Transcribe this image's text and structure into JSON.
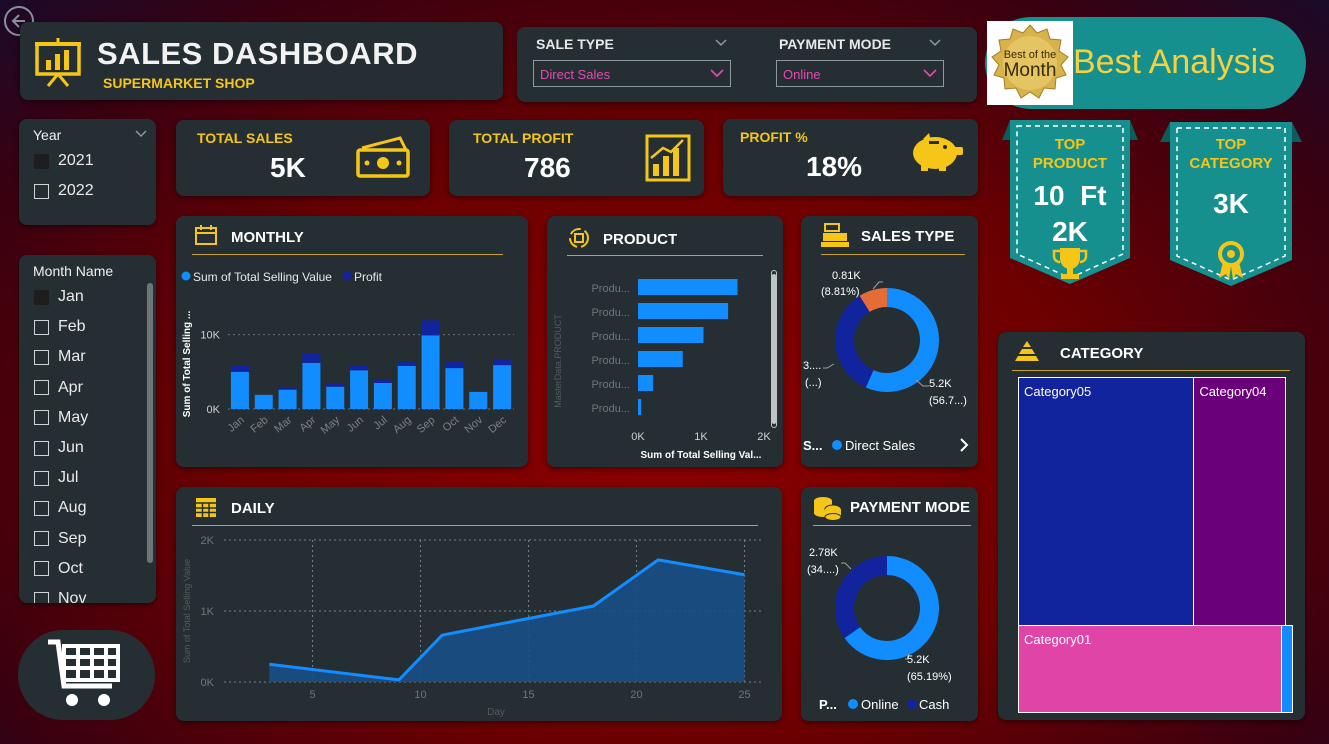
{
  "header": {
    "title": "SALES DASHBOARD",
    "subtitle": "SUPERMARKET SHOP"
  },
  "filters": {
    "sale_type": {
      "label": "SALE TYPE",
      "selected": "Direct Sales"
    },
    "payment_mode": {
      "label": "PAYMENT MODE",
      "selected": "Online"
    }
  },
  "banner": {
    "medal_line1": "Best of the",
    "medal_line2": "Month",
    "text": "Best Analysis"
  },
  "kpis": {
    "total_sales": {
      "label": "TOTAL SALES",
      "value": "5K"
    },
    "total_profit": {
      "label": "TOTAL PROFIT",
      "value": "786"
    },
    "profit_pct": {
      "label": "PROFIT %",
      "value": "18%"
    }
  },
  "ribbons": {
    "top_product": {
      "label_line1": "TOP",
      "label_line2": "PRODUCT",
      "value_line1": "10  Ft",
      "value_line2": "2K"
    },
    "top_category": {
      "label_line1": "TOP",
      "label_line2": "CATEGORY",
      "value": "3K"
    }
  },
  "year_slicer": {
    "title": "Year",
    "items": [
      {
        "label": "2021",
        "checked": true
      },
      {
        "label": "2022",
        "checked": false
      }
    ]
  },
  "month_slicer": {
    "title": "Month Name",
    "items": [
      {
        "label": "Jan",
        "checked": true
      },
      {
        "label": "Feb",
        "checked": false
      },
      {
        "label": "Mar",
        "checked": false
      },
      {
        "label": "Apr",
        "checked": false
      },
      {
        "label": "May",
        "checked": false
      },
      {
        "label": "Jun",
        "checked": false
      },
      {
        "label": "Jul",
        "checked": false
      },
      {
        "label": "Aug",
        "checked": false
      },
      {
        "label": "Sep",
        "checked": false
      },
      {
        "label": "Oct",
        "checked": false
      },
      {
        "label": "Nov",
        "checked": false
      }
    ]
  },
  "colors": {
    "accent": "#f5c518",
    "card": "#252f33",
    "series_blue": "#118dff",
    "series_navy": "#12239e",
    "orange": "#e66c37",
    "teal": "#15908e",
    "purple": "#6b007b",
    "pink": "#e044a7"
  },
  "chart_data": [
    {
      "id": "monthly",
      "type": "bar",
      "title": "MONTHLY",
      "ylabel": "Sum of Total Selling ...",
      "ylim": [
        0,
        12500
      ],
      "yticks": [
        "0K",
        "10K"
      ],
      "legend": [
        "Sum of Total Selling Value",
        "Profit"
      ],
      "categories": [
        "Jan",
        "Feb",
        "Mar",
        "Apr",
        "May",
        "Jun",
        "Jul",
        "Aug",
        "Sep",
        "Oct",
        "Nov",
        "Dec"
      ],
      "series": [
        {
          "name": "Sum of Total Selling Value",
          "values": [
            5000,
            1900,
            2600,
            6200,
            3000,
            5200,
            3500,
            5800,
            9900,
            5500,
            2300,
            5900
          ]
        },
        {
          "name": "Profit",
          "values": [
            900,
            0,
            300,
            1200,
            400,
            700,
            500,
            500,
            2000,
            900,
            0,
            800
          ]
        }
      ]
    },
    {
      "id": "product",
      "type": "bar",
      "title": "PRODUCT",
      "orientation": "horizontal",
      "xlabel": "Sum of Total Selling Val...",
      "ylabel": "MasterData.PRODUCT",
      "xlim": [
        0,
        2000
      ],
      "xticks": [
        "0K",
        "1K",
        "2K"
      ],
      "categories": [
        "Produ...",
        "Produ...",
        "Produ...",
        "Produ...",
        "Produ...",
        "Produ..."
      ],
      "values": [
        1580,
        1430,
        1040,
        710,
        240,
        50
      ]
    },
    {
      "id": "sales_type",
      "type": "pie",
      "title": "SALES TYPE",
      "legend_title": "S...",
      "legend": [
        "Direct Sales"
      ],
      "slices": [
        {
          "label_line1": "5.2K",
          "label_line2": "(56.7...)",
          "value": 56.7,
          "color": "#118dff"
        },
        {
          "label_line1": "3....",
          "label_line2": "(...)",
          "value": 34.49,
          "color": "#12239e"
        },
        {
          "label_line1": "0.81K",
          "label_line2": "(8.81%)",
          "value": 8.81,
          "color": "#e66c37"
        }
      ]
    },
    {
      "id": "payment_mode",
      "type": "pie",
      "title": "PAYMENT MODE",
      "legend_title": "P...",
      "legend": [
        "Online",
        "Cash"
      ],
      "slices": [
        {
          "label_line1": "5.2K",
          "label_line2": "(65.19%)",
          "value": 65.19,
          "color": "#118dff"
        },
        {
          "label_line1": "2.78K",
          "label_line2": "(34....)",
          "value": 34.81,
          "color": "#12239e"
        }
      ]
    },
    {
      "id": "daily",
      "type": "area",
      "title": "DAILY",
      "xlabel": "Day",
      "ylabel": "Sum of Total Selling Value",
      "ylim": [
        0,
        2000
      ],
      "xlim": [
        1,
        25
      ],
      "yticks": [
        "0K",
        "1K",
        "2K"
      ],
      "xticks": [
        5,
        10,
        15,
        20,
        25
      ],
      "x": [
        3,
        9,
        11,
        18,
        21,
        25
      ],
      "y": [
        250,
        30,
        660,
        1070,
        1720,
        1510
      ]
    },
    {
      "id": "category",
      "type": "heatmap",
      "title": "CATEGORY",
      "items": [
        {
          "label": "Category05",
          "value": 2.9
        },
        {
          "label": "Category04",
          "value": 1.5
        },
        {
          "label": "Category01",
          "value": 1.5
        },
        {
          "label": "",
          "value": 0.02
        }
      ]
    }
  ]
}
